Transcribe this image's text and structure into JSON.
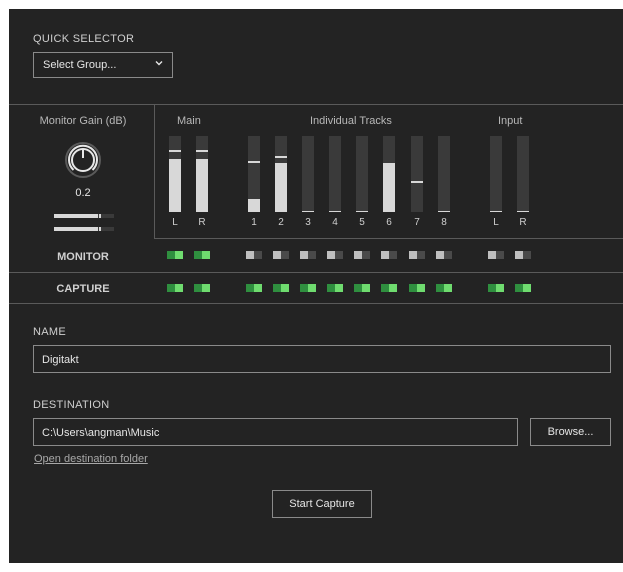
{
  "quick_selector": {
    "title": "QUICK SELECTOR",
    "select_value": "Select Group..."
  },
  "monitor_gain": {
    "title": "Monitor Gain (dB)",
    "value": "0.2"
  },
  "sections": {
    "main": "Main",
    "individual_tracks": "Individual Tracks",
    "input": "Input"
  },
  "meters": {
    "main": [
      {
        "label": "L",
        "level": 0.7,
        "peak": 0.8
      },
      {
        "label": "R",
        "level": 0.7,
        "peak": 0.8
      }
    ],
    "tracks": [
      {
        "label": "1",
        "level": 0.17,
        "peak": 0.66
      },
      {
        "label": "2",
        "level": 0.64,
        "peak": 0.73
      },
      {
        "label": "3",
        "level": 0.0,
        "peak": 0.0
      },
      {
        "label": "4",
        "level": 0.0,
        "peak": 0.0
      },
      {
        "label": "5",
        "level": 0.0,
        "peak": 0.0
      },
      {
        "label": "6",
        "level": 0.63,
        "peak": 0.63
      },
      {
        "label": "7",
        "level": 0.0,
        "peak": 0.4
      },
      {
        "label": "8",
        "level": 0.0,
        "peak": 0.0
      }
    ],
    "input": [
      {
        "label": "L",
        "level": 0.0,
        "peak": 0.0
      },
      {
        "label": "R",
        "level": 0.0,
        "peak": 0.0
      }
    ]
  },
  "rows": {
    "monitor": "MONITOR",
    "capture": "CAPTURE"
  },
  "name": {
    "title": "NAME",
    "value": "Digitakt"
  },
  "destination": {
    "title": "DESTINATION",
    "value": "C:\\Users\\angman\\Music",
    "browse_label": "Browse...",
    "open_folder_label": "Open destination folder"
  },
  "start_capture_label": "Start Capture"
}
